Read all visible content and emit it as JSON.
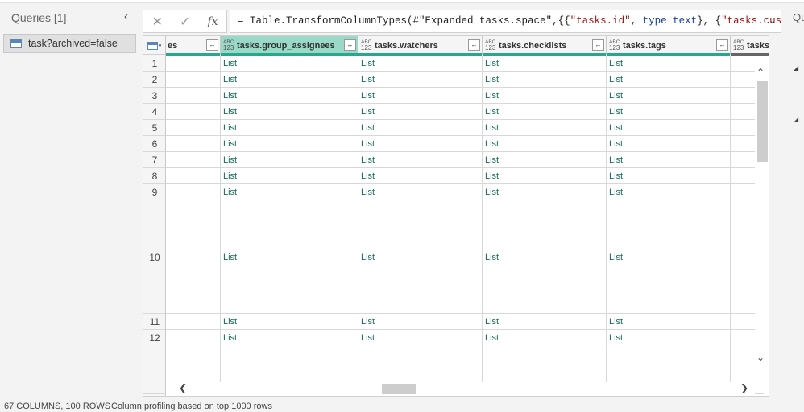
{
  "queries": {
    "title": "Queries [1]",
    "collapse_icon": "chevron-left-icon",
    "items": [
      {
        "label": "task?archived=false",
        "icon": "table-icon"
      }
    ]
  },
  "formula_bar": {
    "cancel_icon": "close-icon",
    "commit_icon": "checkmark-icon",
    "fx_label": "fx",
    "formula_prefix": "= Table.TransformColumnTypes(#\"Expanded tasks.space\",{{",
    "str1": "\"tasks.id\"",
    "sep1": ", ",
    "kw1": "type",
    "sep2": " ",
    "kw2": "text",
    "sep3": "}, {",
    "str2": "\"tasks.custom_id\"",
    "sep4": ",",
    "expand_icon": "chevron-down-icon"
  },
  "grid": {
    "columns": [
      {
        "name": "es",
        "type": "",
        "selected": false
      },
      {
        "name": "tasks.group_assignees",
        "type": "ABC 123",
        "selected": true
      },
      {
        "name": "tasks.watchers",
        "type": "ABC 123",
        "selected": false
      },
      {
        "name": "tasks.checklists",
        "type": "ABC 123",
        "selected": false
      },
      {
        "name": "tasks.tags",
        "type": "ABC 123",
        "selected": false
      },
      {
        "name": "tasks.par",
        "type": "ABC 123",
        "selected": false
      }
    ],
    "rows": [
      {
        "n": "1",
        "vals": [
          "",
          "List",
          "List",
          "List",
          "List"
        ]
      },
      {
        "n": "2",
        "vals": [
          "",
          "List",
          "List",
          "List",
          "List"
        ]
      },
      {
        "n": "3",
        "vals": [
          "",
          "List",
          "List",
          "List",
          "List"
        ]
      },
      {
        "n": "4",
        "vals": [
          "",
          "List",
          "List",
          "List",
          "List"
        ]
      },
      {
        "n": "5",
        "vals": [
          "",
          "List",
          "List",
          "List",
          "List"
        ]
      },
      {
        "n": "6",
        "vals": [
          "",
          "List",
          "List",
          "List",
          "List"
        ]
      },
      {
        "n": "7",
        "vals": [
          "",
          "List",
          "List",
          "List",
          "List"
        ]
      },
      {
        "n": "8",
        "vals": [
          "",
          "List",
          "List",
          "List",
          "List"
        ]
      },
      {
        "n": "9",
        "vals": [
          "",
          "List",
          "List",
          "List",
          "List"
        ]
      },
      {
        "n": "10",
        "vals": [
          "",
          "List",
          "List",
          "List",
          "List"
        ]
      },
      {
        "n": "11",
        "vals": [
          "",
          "List",
          "List",
          "List",
          "List"
        ]
      },
      {
        "n": "12",
        "vals": [
          "",
          "List",
          "List",
          "List",
          "List"
        ]
      }
    ],
    "quality_color": "#22aa90",
    "selected_header_color": "#9ad9c8",
    "value_color": "#1a6b5a"
  },
  "right_pane": {
    "title": "Qu"
  },
  "status": {
    "columns_rows": "67 COLUMNS, 100 ROWS",
    "profiling": "Column profiling based on top 1000 rows"
  }
}
